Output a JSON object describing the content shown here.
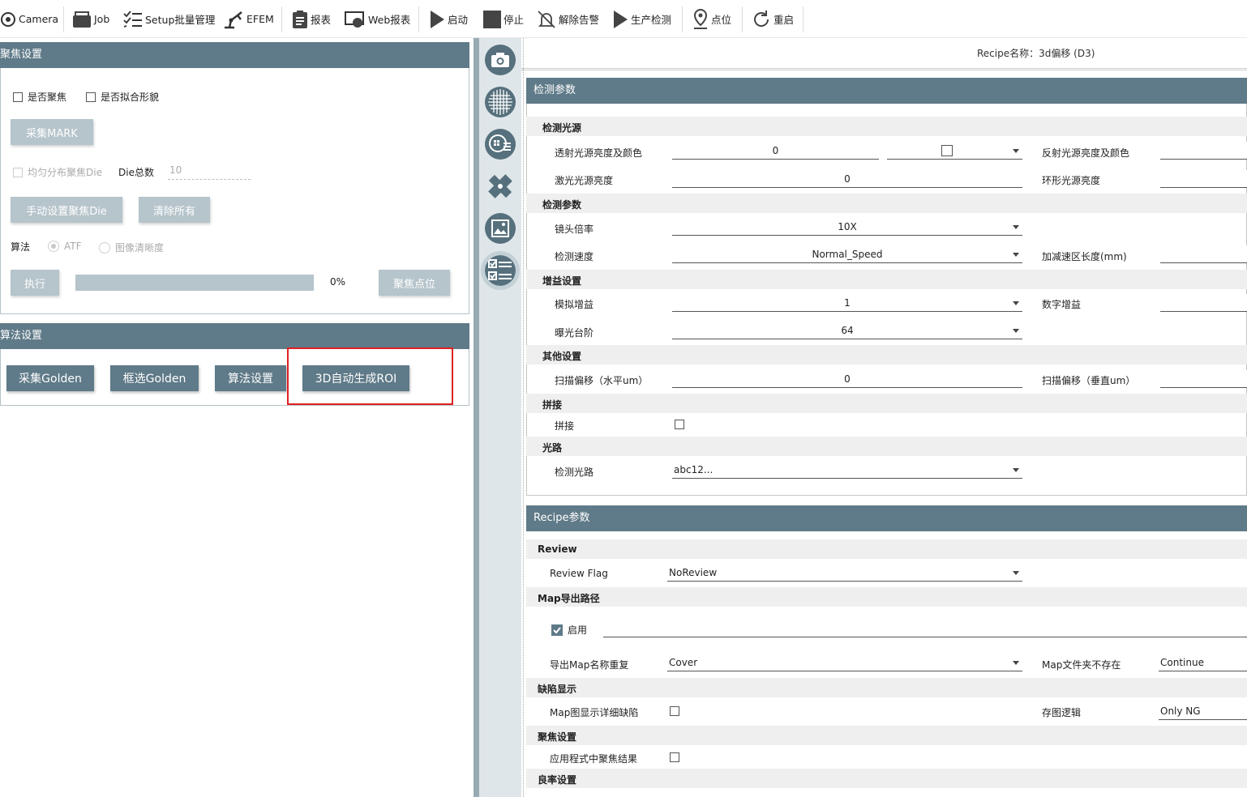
{
  "toolbar": {
    "items": [
      {
        "label": "Camera",
        "icon": "camera-icon"
      },
      {
        "label": "Job",
        "icon": "briefcase-icon"
      },
      {
        "label": "Setup批量管理",
        "icon": "checklist-icon"
      },
      {
        "label": "EFEM",
        "icon": "robot-arm-icon"
      },
      {
        "label": "报表",
        "icon": "report-icon"
      },
      {
        "label": "Web报表",
        "icon": "web-report-icon"
      },
      {
        "label": "启动",
        "icon": "play-icon"
      },
      {
        "label": "停止",
        "icon": "stop-icon"
      },
      {
        "label": "解除告警",
        "icon": "bell-off-icon"
      },
      {
        "label": "生产检测",
        "icon": "play-icon"
      },
      {
        "label": "点位",
        "icon": "location-pin-icon"
      },
      {
        "label": "重启",
        "icon": "restart-icon"
      }
    ]
  },
  "focus_panel": {
    "title": "聚焦设置",
    "chk_focus": "是否聚焦",
    "chk_fit": "是否拟合形貌",
    "btn_mark": "采集MARK",
    "chk_uniform": "均匀分布聚焦Die",
    "die_total_label": "Die总数",
    "die_total_value": "10",
    "btn_manual": "手动设置聚焦Die",
    "btn_clear": "清除所有",
    "algo_label": "算法",
    "radio_atf": "ATF",
    "radio_img": "图像清晰度",
    "btn_exec": "执行",
    "progress_text": "0%",
    "progress_value": 0,
    "btn_focus_point": "聚焦点位"
  },
  "algo_panel": {
    "title": "算法设置",
    "btn_golden": "采集Golden",
    "btn_box_golden": "框选Golden",
    "btn_algo": "算法设置",
    "btn_roi": "3D自动生成ROI"
  },
  "sidebar": {
    "icons": [
      "camera-icon",
      "wafer-grid-icon",
      "die-map-icon",
      "ruler-tools-icon",
      "image-frame-icon",
      "checklist-icon"
    ]
  },
  "recipe_header": {
    "title": "Recipe名称：3d偏移 (D3)"
  },
  "detect": {
    "title": "检测参数",
    "g_light": "检测光源",
    "trans_label": "透射光源亮度及颜色",
    "trans_value": "0",
    "refl_label": "反射光源亮度及颜色",
    "laser_label": "激光光源亮度",
    "laser_value": "0",
    "ring_label": "环形光源亮度",
    "g_params": "检测参数",
    "lens_label": "镜头倍率",
    "lens_value": "10X",
    "speed_label": "检测速度",
    "speed_value": "Normal_Speed",
    "accel_label": "加减速区长度(mm)",
    "g_gain": "增益设置",
    "analog_label": "模拟增益",
    "analog_value": "1",
    "digital_label": "数字增益",
    "expo_label": "曝光台阶",
    "expo_value": "64",
    "g_other": "其他设置",
    "scanh_label": "扫描偏移（水平um）",
    "scanh_value": "0",
    "scanv_label": "扫描偏移（垂直um）",
    "g_stitch": "拼接",
    "stitch_label": "拼接",
    "g_optic": "光路",
    "optic_label": "检测光路",
    "optic_value": "abc12..."
  },
  "recipe": {
    "title": "Recipe参数",
    "g_review": "Review",
    "review_flag_label": "Review Flag",
    "review_flag_value": "NoReview",
    "g_map": "Map导出路径",
    "enable_label": "启用",
    "dup_label": "导出Map名称重复",
    "dup_value": "Cover",
    "nofolder_label": "Map文件夹不存在",
    "nofolder_value": "Continue",
    "g_defect": "缺陷显示",
    "detail_label": "Map图显示详细缺陷",
    "save_label": "存图逻辑",
    "save_value": "Only NG",
    "g_focus": "聚焦设置",
    "apply_label": "应用程式中聚焦结果",
    "g_yield": "良率设置"
  },
  "colors": {
    "header": "#5f7a88",
    "disabled_button": "#b6c4cb",
    "highlight": "#e02020"
  }
}
